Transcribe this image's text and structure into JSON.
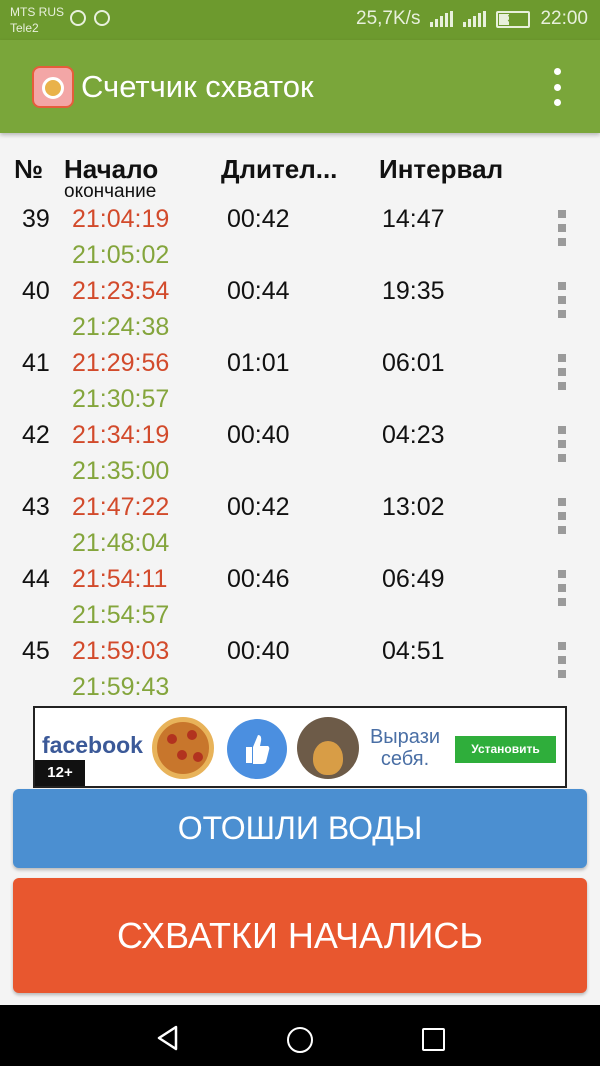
{
  "status_bar": {
    "carrier1": "MTS RUS",
    "carrier2": "Tele2",
    "speed": "25,7K/s",
    "battery": "35",
    "battery_level": 0.35,
    "time": "22:00"
  },
  "app_bar": {
    "title": "Счетчик схваток",
    "accent_color": "#7aa63a",
    "menu_icon": "more-vert-icon"
  },
  "table": {
    "headers": {
      "num": "№",
      "start": "Начало",
      "end": "окончание",
      "duration": "Длител...",
      "interval": "Интервал"
    },
    "rows": [
      {
        "num": "39",
        "start": "21:04:19",
        "end": "21:05:02",
        "duration": "00:42",
        "interval": "14:47"
      },
      {
        "num": "40",
        "start": "21:23:54",
        "end": "21:24:38",
        "duration": "00:44",
        "interval": "19:35"
      },
      {
        "num": "41",
        "start": "21:29:56",
        "end": "21:30:57",
        "duration": "01:01",
        "interval": "06:01"
      },
      {
        "num": "42",
        "start": "21:34:19",
        "end": "21:35:00",
        "duration": "00:40",
        "interval": "04:23"
      },
      {
        "num": "43",
        "start": "21:47:22",
        "end": "21:48:04",
        "duration": "00:42",
        "interval": "13:02"
      },
      {
        "num": "44",
        "start": "21:54:11",
        "end": "21:54:57",
        "duration": "00:46",
        "interval": "06:49"
      },
      {
        "num": "45",
        "start": "21:59:03",
        "end": "21:59:43",
        "duration": "00:40",
        "interval": "04:51"
      }
    ],
    "colors": {
      "start": "#d24a2b",
      "end": "#84a53c"
    }
  },
  "ad": {
    "brand": "facebook",
    "line1": "Вырази",
    "line2": "себя.",
    "button": "Установить",
    "age": "12+"
  },
  "actions": {
    "water_label": "ОТОШЛИ ВОДЫ",
    "water_color": "#4b8fd1",
    "start_label": "СХВАТКИ НАЧАЛИСЬ",
    "start_color": "#e8572f"
  },
  "nav": {
    "back_icon": "back-triangle-icon",
    "home_icon": "home-circle-icon",
    "recents_icon": "recents-square-icon"
  }
}
